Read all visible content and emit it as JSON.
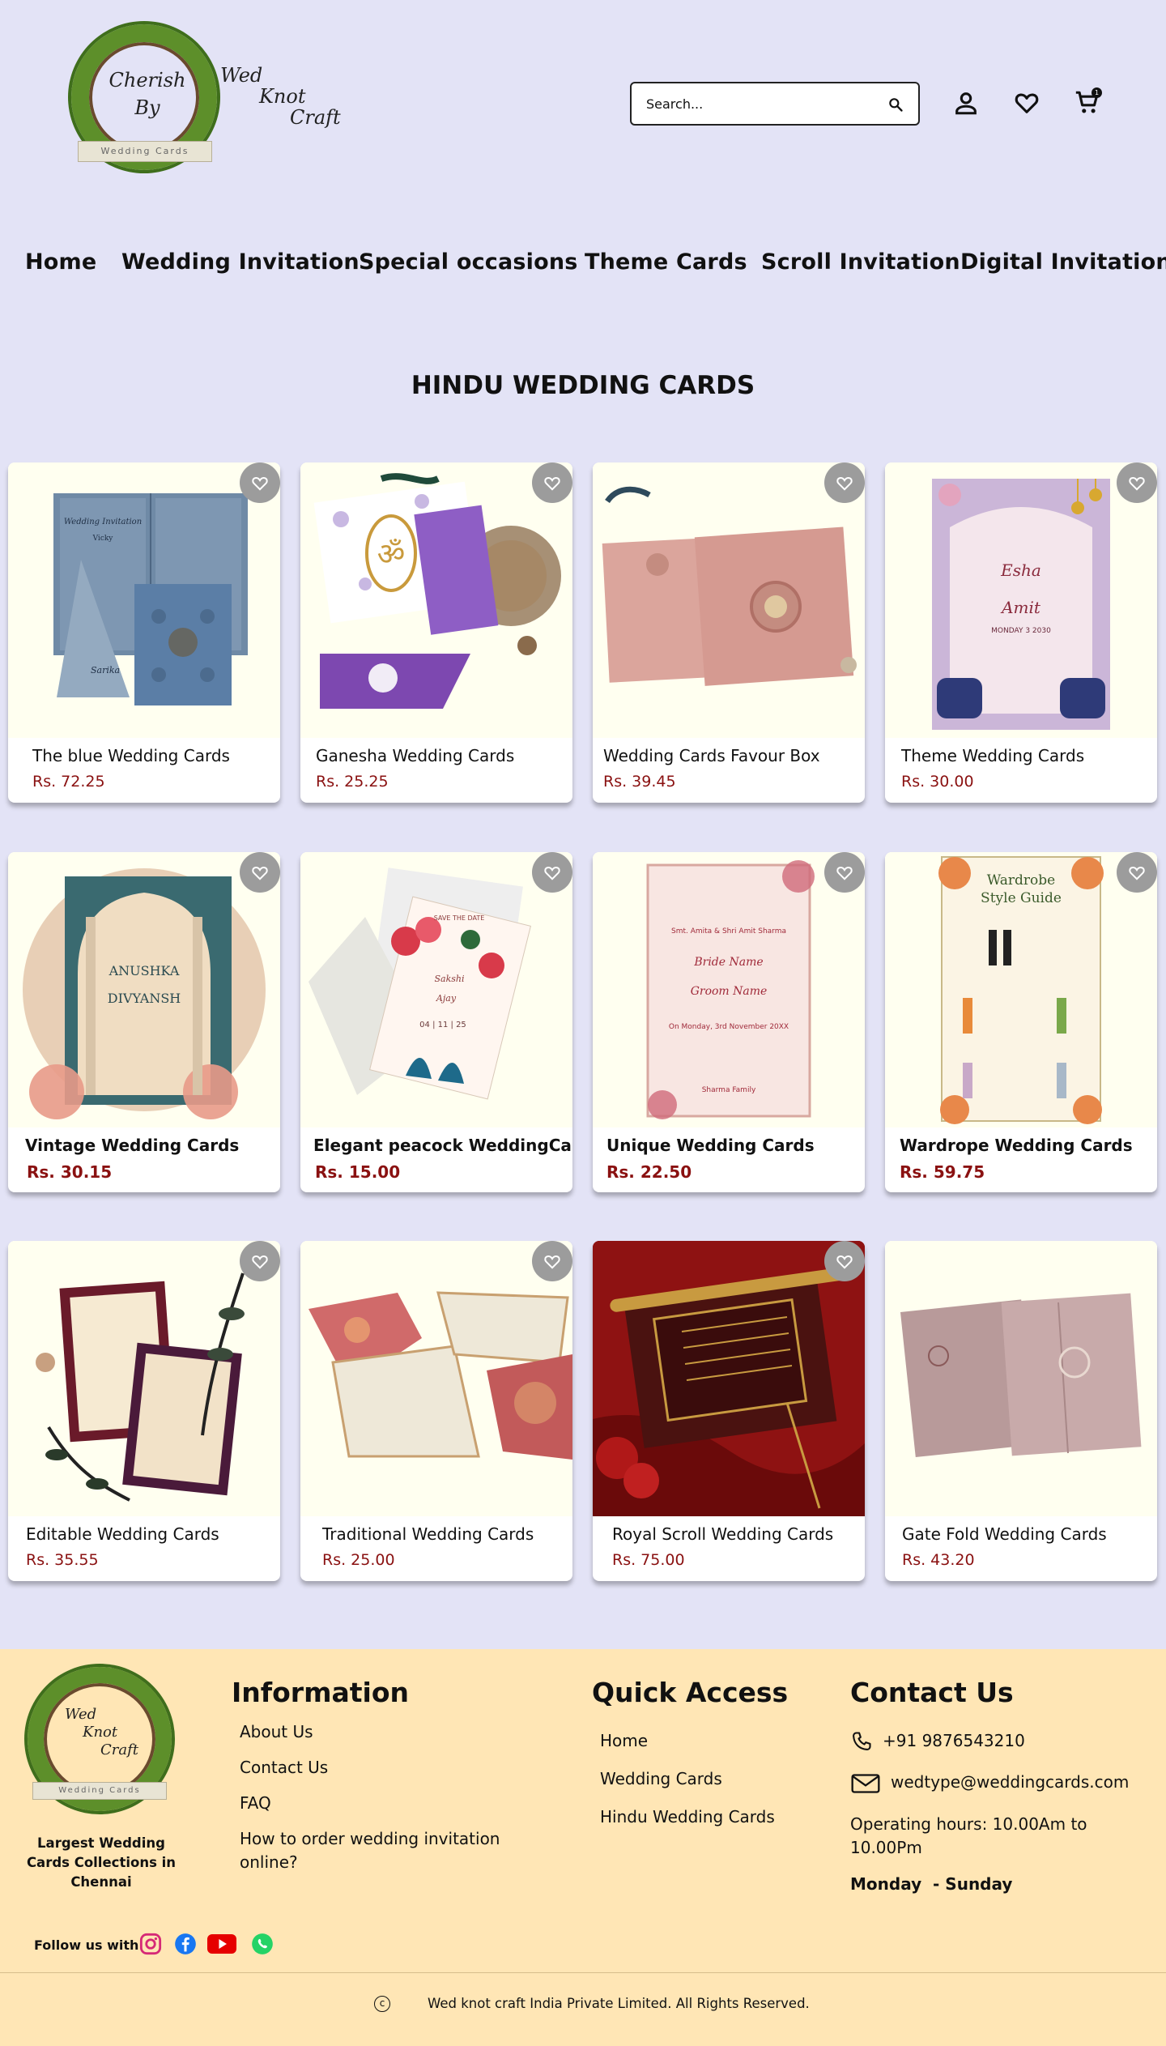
{
  "brand": {
    "wreath_line1": "Cherish",
    "wreath_line2": "By",
    "side_line1": "Wed",
    "side_line2": "Knot",
    "side_line3": "Craft",
    "ribbon": "Wedding Cards"
  },
  "search": {
    "placeholder": "Search..."
  },
  "cart": {
    "count": "1"
  },
  "nav": {
    "items": [
      "Home",
      "Wedding Invitation",
      "Special occasions",
      "Theme Cards",
      "Scroll Invitation",
      "Digital Invitation"
    ]
  },
  "section": {
    "title": "HINDU WEDDING CARDS"
  },
  "products": [
    {
      "name": "The blue Wedding Cards",
      "price": "Rs. 72.25"
    },
    {
      "name": "Ganesha Wedding Cards",
      "price": "Rs. 25.25"
    },
    {
      "name": "Wedding Cards Favour Box",
      "price": "Rs. 39.45"
    },
    {
      "name": "Theme Wedding Cards",
      "price": "Rs. 30.00"
    },
    {
      "name": "Vintage Wedding Cards",
      "price": "Rs. 30.15"
    },
    {
      "name": "Elegant peacock WeddingCards",
      "price": "Rs. 15.00"
    },
    {
      "name": "Unique Wedding Cards",
      "price": "Rs. 22.50"
    },
    {
      "name": "Wardrope Wedding Cards",
      "price": "Rs. 59.75"
    },
    {
      "name": "Editable Wedding Cards",
      "price": "Rs. 35.55"
    },
    {
      "name": "Traditional Wedding Cards",
      "price": "Rs. 25.00"
    },
    {
      "name": "Royal Scroll Wedding Cards",
      "price": "Rs. 75.00"
    },
    {
      "name": "Gate Fold Wedding Cards",
      "price": "Rs. 43.20"
    }
  ],
  "product_art": {
    "p1": {
      "header": "Wedding Invitation",
      "name1": "Vicky",
      "name2": "Sarika"
    },
    "p2": {
      "symbol": "ॐ"
    },
    "p4": {
      "name1": "Esha",
      "name2": "Amit",
      "date": "MONDAY 3 2030"
    },
    "p5": {
      "name1": "ANUSHKA",
      "name2": "DIVYANSH"
    },
    "p6": {
      "header": "SAVE THE DATE",
      "name1": "Sakshi",
      "name2": "Ajay",
      "date": "04 | 11 | 25"
    },
    "p7": {
      "parents": "Smt. Amita & Shri Amit Sharma",
      "bride": "Bride Name",
      "groom": "Groom Name",
      "date": "On Monday, 3rd November 20XX",
      "family": "Sharma Family"
    },
    "p8": {
      "header1": "Wardrobe",
      "header2": "Style Guide"
    }
  },
  "footer": {
    "logo_line1": "Wed",
    "logo_line2": "Knot",
    "logo_line3": "Craft",
    "logo_ribbon": "Wedding Cards",
    "tagline": "Largest Wedding Cards Collections in Chennai",
    "info_heading": "Information",
    "info_links": [
      "About Us",
      "Contact Us",
      "FAQ",
      "How to order wedding invitation online?"
    ],
    "quick_heading": "Quick Access",
    "quick_links": [
      "Home",
      "Wedding Cards",
      "Hindu Wedding Cards"
    ],
    "contact_heading": "Contact Us",
    "phone": "+91 9876543210",
    "email": "wedtype@weddingcards.com",
    "hours": "Operating hours: 10.00Am to 10.00Pm",
    "days": "Monday  - Sunday",
    "follow_label": "Follow us with",
    "copyright_symbol": "c",
    "copyright": "Wed knot craft India Private Limited. All Rights Reserved."
  },
  "colors": {
    "page_bg": "#e3e3f6",
    "footer_bg": "#ffe6b5",
    "price": "#8a1111",
    "card_image_bg": "#fffff0"
  }
}
